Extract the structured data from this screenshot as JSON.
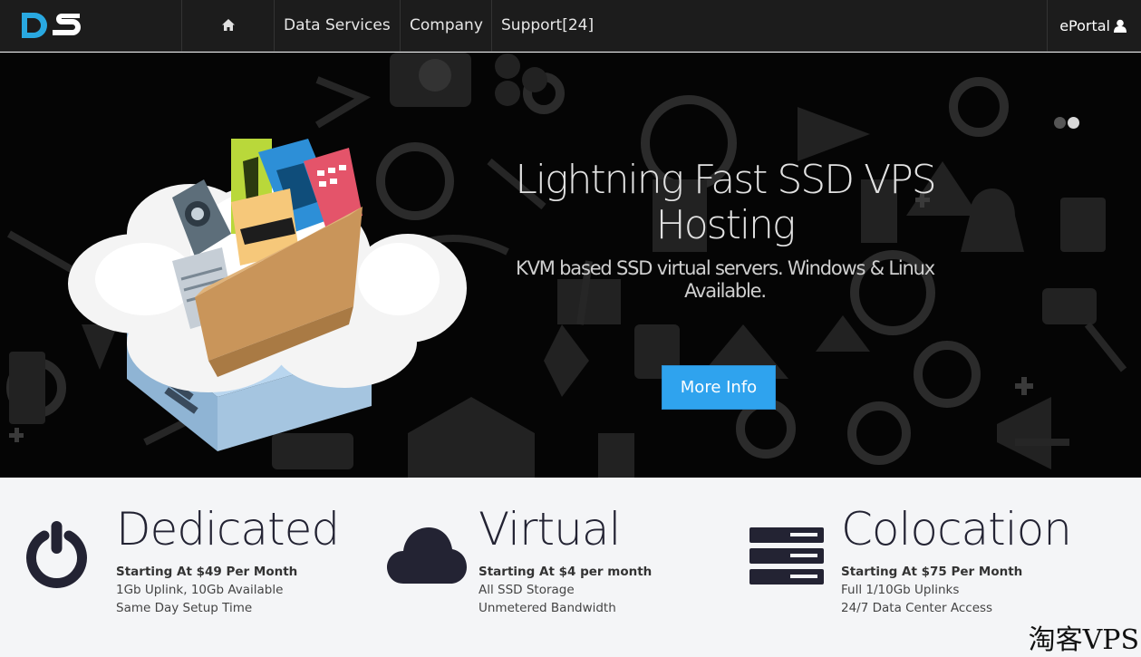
{
  "nav": {
    "logo": "DS",
    "home_icon": "home-icon",
    "items": [
      {
        "label": "Data Services"
      },
      {
        "label": "Company"
      },
      {
        "label": "Support[24]"
      }
    ],
    "eportal_label": "ePortal",
    "user_icon": "user-icon"
  },
  "hero": {
    "title_line1": "Lightning Fast SSD VPS",
    "title_line2": "Hosting",
    "subtitle_line1": "KVM based SSD virtual servers. Windows & Linux",
    "subtitle_line2": "Available.",
    "button_label": "More Info",
    "slides": 2,
    "active_slide": 2,
    "button_color": "#2fa3ee"
  },
  "services": [
    {
      "icon": "power-icon",
      "title": "Dedicated",
      "price": "Starting At $49 Per Month",
      "lines": [
        "1Gb Uplink, 10Gb Available",
        "Same Day Setup Time"
      ]
    },
    {
      "icon": "cloud-icon",
      "title": "Virtual",
      "price": "Starting At $4 per month",
      "lines": [
        "All SSD Storage",
        "Unmetered Bandwidth"
      ]
    },
    {
      "icon": "server-rack-icon",
      "title": "Colocation",
      "price": "Starting At $75 Per Month",
      "lines": [
        "Full 1/10Gb Uplinks",
        "24/7 Data Center Access"
      ]
    }
  ],
  "watermark": "淘客VPS",
  "colors": {
    "nav_bg": "#1c1c1c",
    "hero_bg": "#050505",
    "accent": "#2fa3ee",
    "services_bg": "#f4f5f7",
    "icon_dark": "#232333",
    "logo_blue": "#29a8e0"
  }
}
